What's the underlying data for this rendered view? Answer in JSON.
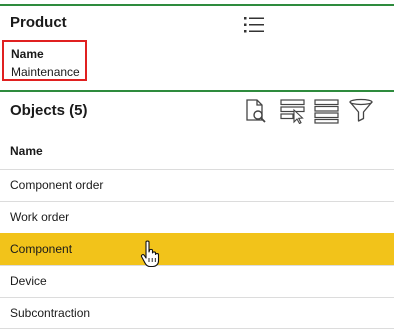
{
  "product": {
    "title": "Product",
    "name_label": "Name",
    "name_value": "Maintenance"
  },
  "objects": {
    "title": "Objects (5)",
    "column_header": "Name",
    "rows": [
      {
        "label": "Component order",
        "selected": false
      },
      {
        "label": "Work order",
        "selected": false
      },
      {
        "label": "Component",
        "selected": true
      },
      {
        "label": "Device",
        "selected": false
      },
      {
        "label": "Subcontraction",
        "selected": false
      }
    ]
  },
  "icons": {
    "menu": "list-menu-icon",
    "tools": [
      "document-search-icon",
      "select-rows-icon",
      "table-rows-icon",
      "filter-icon"
    ],
    "cursor": "hand-pointer-icon"
  },
  "colors": {
    "accent_line": "#2e8b3d",
    "highlight_box": "#e02020",
    "selected_row": "#f2c31a"
  }
}
